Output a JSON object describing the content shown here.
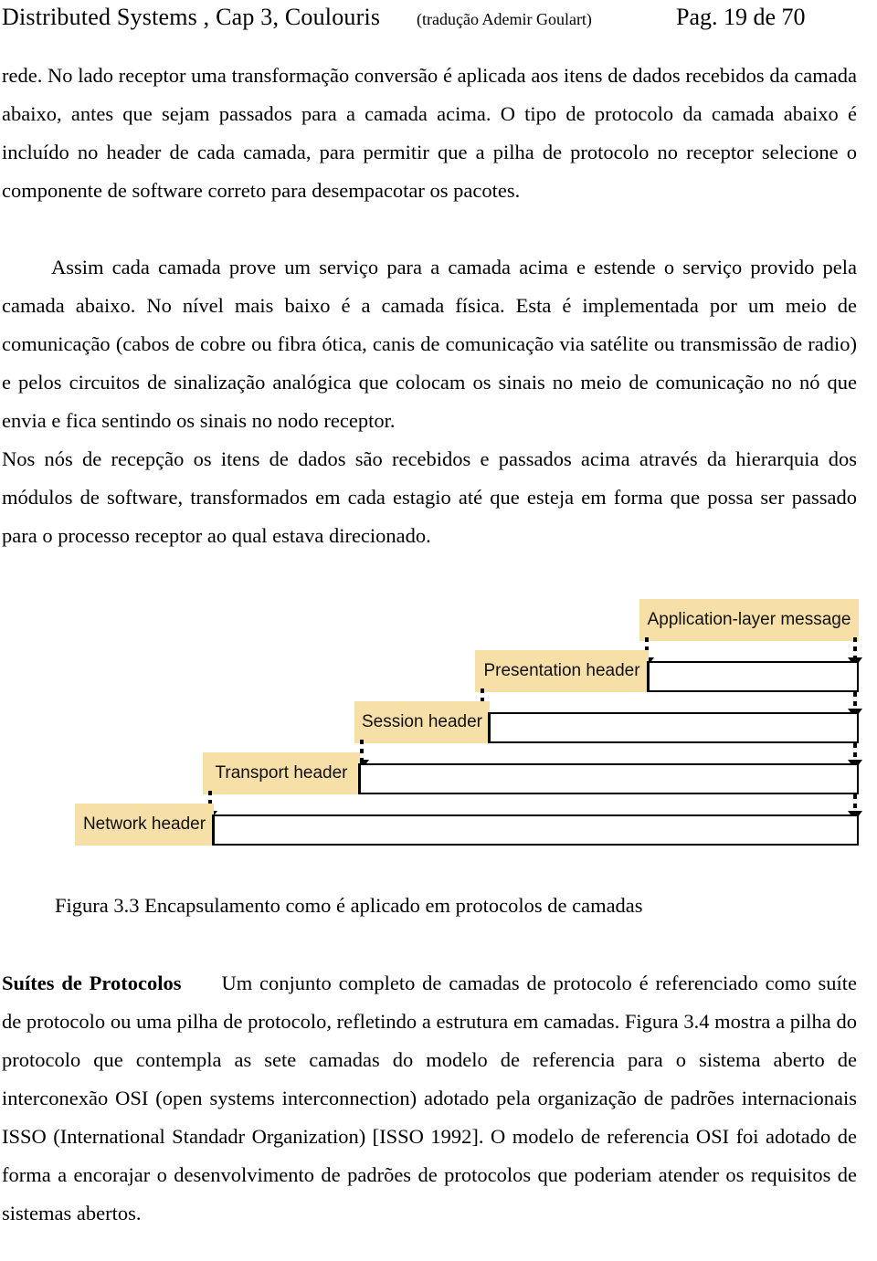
{
  "header": {
    "left": "Distributed Systems ,  Cap 3,  Coulouris",
    "center": "(tradução Ademir Goulart)",
    "right": "Pag. 19 de 70"
  },
  "body": {
    "paragraph_1": "rede. No lado receptor uma transformação conversão é aplicada aos itens de dados recebidos da camada abaixo, antes que sejam passados para a camada acima. O tipo de protocolo da camada abaixo é incluído no header de cada camada, para permitir que a pilha de protocolo no receptor selecione o componente de software correto para desempacotar os pacotes.",
    "paragraph_2": "Assim cada camada prove um serviço para a camada acima e estende o serviço provido pela camada abaixo. No nível mais baixo é a camada física. Esta é implementada por um meio de comunicação (cabos de cobre ou fibra ótica, canis de comunicação via satélite ou transmissão de radio) e pelos circuitos de sinalização analógica que colocam os sinais no meio de comunicação no nó que envia e fica sentindo os sinais no nodo receptor.",
    "paragraph_3": "Nos nós de recepção os itens de dados são recebidos e passados acima através da hierarquia dos módulos de software, transformados em cada estagio até que esteja em forma que possa ser passado para o processo receptor ao qual estava direcionado."
  },
  "figure": {
    "caption": "Figura 3.3  Encapsulamento como é aplicado em protocolos de camadas",
    "label_background_color": "#F7DFA8",
    "layers": [
      {
        "label": "Application-layer message"
      },
      {
        "label": "Presentation header"
      },
      {
        "label": "Session header"
      },
      {
        "label": "Transport header"
      },
      {
        "label": "Network header"
      }
    ]
  },
  "section": {
    "heading": "Suítes de Protocolos",
    "text_after_heading": "Um conjunto completo de camadas de protocolo é referenciado como suíte de protocolo ou uma pilha de protocolo, refletindo a estrutura em camadas. Figura 3.4 mostra a pilha do protocolo que contempla as sete camadas do modelo de referencia para o sistema aberto de interconexão OSI (open systems interconnection) adotado pela organização de padrões internacionais ISSO (International Standadr Organization) [ISSO 1992]. O modelo de referencia OSI foi adotado de forma a encorajar o desenvolvimento de padrões de protocolos que poderiam atender os requisitos de sistemas abertos."
  }
}
